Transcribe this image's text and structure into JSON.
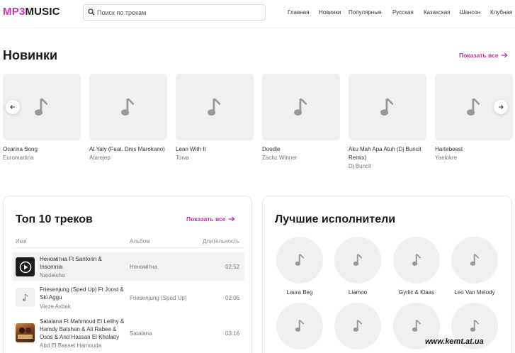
{
  "header": {
    "logo_part1": "MP3",
    "logo_part2": "MUSIC",
    "search_placeholder": "Поиск по трекам",
    "nav": [
      "Главная",
      "Новинки",
      "Популярные",
      "Русская",
      "Казахская",
      "Шансон",
      "Клубная"
    ]
  },
  "new_releases": {
    "title": "Новинки",
    "show_all": "Показать все",
    "cards": [
      {
        "title": "Ocarina Song",
        "artist": "Euromartina"
      },
      {
        "title": "At Yaly (Feat. Dms Marokano)",
        "artist": "Atarejep"
      },
      {
        "title": "Lean With It",
        "artist": "Towa"
      },
      {
        "title": "Doodle",
        "artist": "Zachz Winner"
      },
      {
        "title": "Aku Mah Apa Atuh (Dj Buncit Remix)",
        "artist": "Dj Buncit"
      },
      {
        "title": "Hartebeest",
        "artist": "Yaelokre"
      }
    ]
  },
  "top_tracks": {
    "title": "Топ 10 треков",
    "show_all": "Показать все",
    "columns": {
      "name": "Имя",
      "album": "Альбом",
      "duration": "Длительность"
    },
    "tracks": [
      {
        "name": "Неномітна Ft Santorin & Insomnia",
        "artist": "Nasteisha",
        "album": "Неномітна",
        "duration": "02:52"
      },
      {
        "name": "Friesenjung (Sped Up) Ft Joost & Ski Aggu",
        "artist": "Vieze Asbak",
        "album": "Friesenjung (Sped Up)",
        "duration": "02:06"
      },
      {
        "name": "Satalana Ft Mahmoud El Leithy & Hamdy Batshan & Ali Rabee & Osos & And Hassan El Kholaey",
        "artist": "Abd El Basset Hamouda",
        "album": "Satalana",
        "duration": "03:16"
      }
    ]
  },
  "best_artists": {
    "title": "Лучшие исполнители",
    "artists": [
      "Laura Beg",
      "Liamoo",
      "Gyrlic & Klaas",
      "Leo Van Melody"
    ]
  },
  "watermark": "www.kemt.at.ua",
  "colors": {
    "accent": "#c0309e",
    "logo_accent": "#cc33aa",
    "placeholder_bg": "#f0f0f0",
    "icon_gray": "#999999"
  }
}
